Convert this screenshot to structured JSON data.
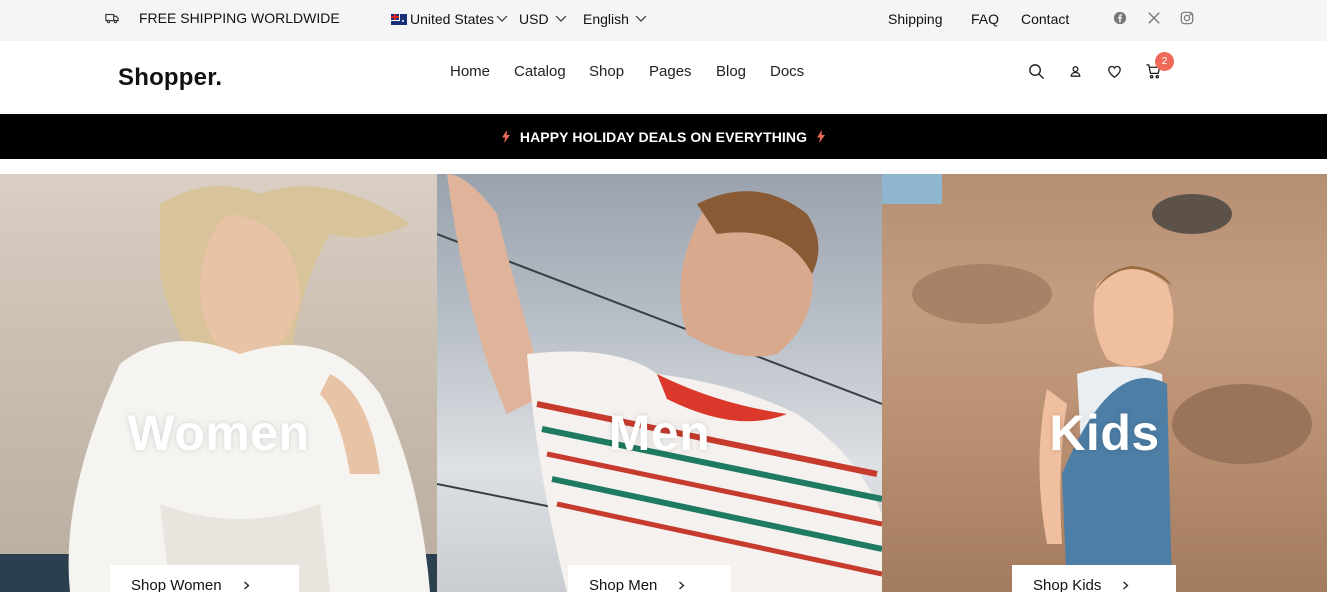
{
  "topbar": {
    "shipping_text": "FREE SHIPPING WORLDWIDE",
    "country": "United States",
    "currency": "USD",
    "language": "English",
    "links": [
      "Shipping",
      "FAQ",
      "Contact"
    ],
    "social_icons": [
      "facebook-icon",
      "x-twitter-icon",
      "instagram-icon"
    ]
  },
  "header": {
    "logo": "Shopper.",
    "nav": [
      "Home",
      "Catalog",
      "Shop",
      "Pages",
      "Blog",
      "Docs"
    ],
    "cart_count": "2"
  },
  "promo": {
    "text": "HAPPY HOLIDAY DEALS ON EVERYTHING",
    "accent": "#ef6a58"
  },
  "categories": [
    {
      "title": "Women",
      "button": "Shop Women"
    },
    {
      "title": "Men",
      "button": "Shop Men"
    },
    {
      "title": "Kids",
      "button": "Shop Kids"
    }
  ]
}
